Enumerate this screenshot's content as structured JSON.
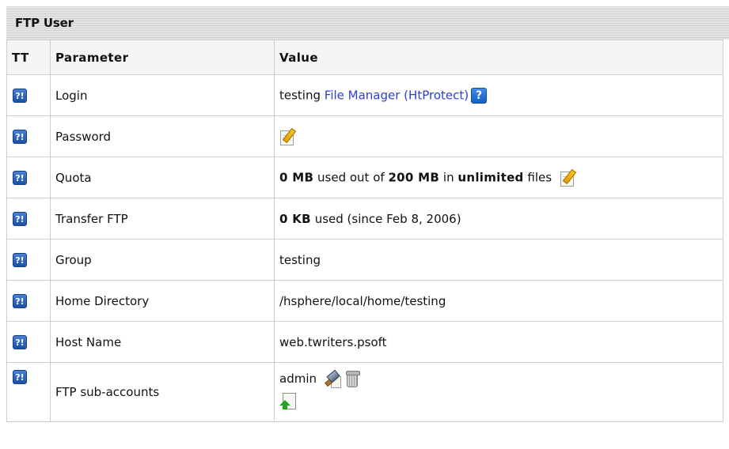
{
  "panel": {
    "title": "FTP User"
  },
  "table": {
    "headers": {
      "tt": "TT",
      "parameter": "Parameter",
      "value": "Value"
    },
    "hint_glyph": "?!",
    "rows": {
      "login": {
        "parameter": "Login",
        "username": "testing",
        "link": "File Manager (HtProtect)",
        "help_glyph": "?"
      },
      "password": {
        "parameter": "Password"
      },
      "quota": {
        "parameter": "Quota",
        "used": "0 MB",
        "text1": "used out of",
        "total": "200 MB",
        "text2": "in",
        "files": "unlimited",
        "text3": "files"
      },
      "transfer": {
        "parameter": "Transfer FTP",
        "amount": "0 KB",
        "text": "used (since Feb 8, 2006)"
      },
      "group": {
        "parameter": "Group",
        "value": "testing"
      },
      "home_directory": {
        "parameter": "Home Directory",
        "value": "/hsphere/local/home/testing"
      },
      "host_name": {
        "parameter": "Host Name",
        "value": "web.twriters.psoft"
      },
      "sub_accounts": {
        "parameter": "FTP sub-accounts",
        "account": "admin"
      }
    }
  },
  "icons": {
    "hint": "hint-icon",
    "help": "help-icon",
    "edit": "edit-icon",
    "manage": "hammer-icon",
    "delete": "trash-icon",
    "add": "add-icon"
  },
  "colors": {
    "link": "#2a3fd4",
    "hint_icon": "#1f4fa8",
    "add_arrow": "#1fa521"
  }
}
